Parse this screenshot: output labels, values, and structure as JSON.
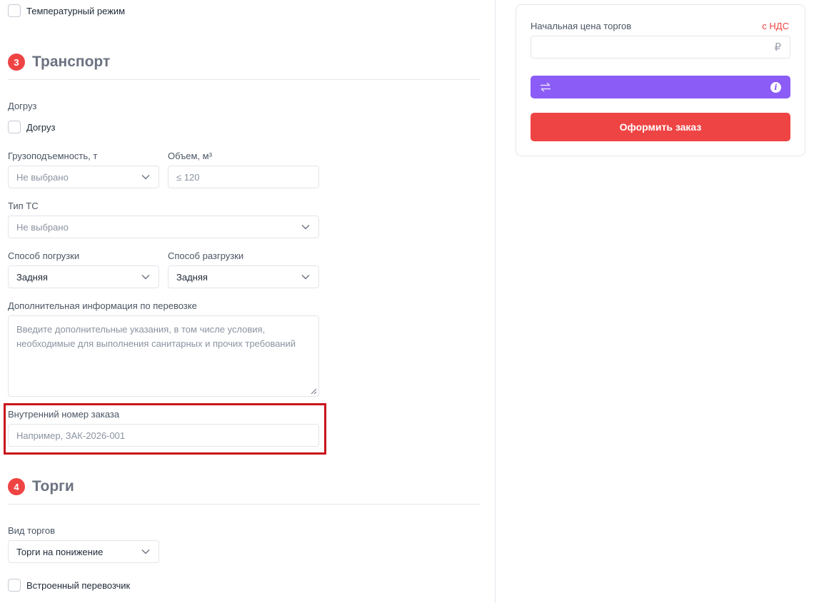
{
  "top_checkbox": {
    "label": "Температурный режим"
  },
  "sections": {
    "transport": {
      "number": "3",
      "title": "Транспорт"
    },
    "auction": {
      "number": "4",
      "title": "Торги"
    }
  },
  "dogruz": {
    "group_label": "Догруз",
    "checkbox_label": "Догруз"
  },
  "capacity": {
    "label": "Грузоподъемность, т",
    "value": "Не выбрано"
  },
  "volume": {
    "label": "Объем, м³",
    "placeholder": "≤ 120"
  },
  "vehicle_type": {
    "label": "Тип ТС",
    "value": "Не выбрано"
  },
  "loading_method": {
    "label": "Способ погрузки",
    "value": "Задняя"
  },
  "unloading_method": {
    "label": "Способ разгрузки",
    "value": "Задняя"
  },
  "additional_info": {
    "label": "Дополнительная информация по перевозке",
    "placeholder": "Введите дополнительные указания, в том числе условия, необходимые для выполнения санитарных и прочих требований"
  },
  "internal_order": {
    "label": "Внутренний номер заказа",
    "placeholder": "Например, ЗАК-2026-001"
  },
  "auction_type": {
    "label": "Вид торгов",
    "value": "Торги на понижение"
  },
  "builtin_carrier": {
    "label": "Встроенный перевозчик"
  },
  "price_card": {
    "start_price_label": "Начальная цена торгов",
    "vat_label": "с НДС",
    "currency_symbol": "₽",
    "submit_label": "Оформить заказ"
  },
  "colors": {
    "accent_red": "#ef4444",
    "accent_purple": "#8b5cf6",
    "highlight_border": "#c8151b"
  },
  "icons": [
    "chevron-down-icon",
    "swap-arrows-icon",
    "info-icon",
    "resize-grip-icon"
  ]
}
